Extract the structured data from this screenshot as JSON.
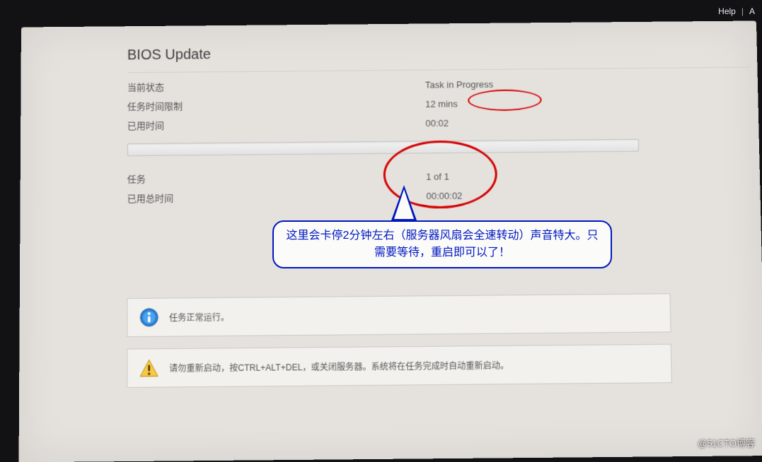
{
  "menubar": {
    "help": "Help",
    "next_partial": "A"
  },
  "page_title": "BIOS Update",
  "status": {
    "current_state_label": "当前状态",
    "current_state_value": "Task in Progress",
    "time_limit_label": "任务时间限制",
    "time_limit_value": "12 mins",
    "elapsed_label": "已用时间",
    "elapsed_value": "00:02"
  },
  "task": {
    "task_label": "任务",
    "task_value": "1 of 1",
    "total_elapsed_label": "已用总时间",
    "total_elapsed_value": "00:00:02"
  },
  "info_msg": "任务正常运行。",
  "warn_msg": "请勿重新启动，按CTRL+ALT+DEL，或关闭服务器。系统将在任务完成时自动重新启动。",
  "annotation_text": "这里会卡停2分钟左右（服务器风扇会全速转动）声音特大。只需要等待，重启即可以了！",
  "watermark": "@51CTO博客"
}
